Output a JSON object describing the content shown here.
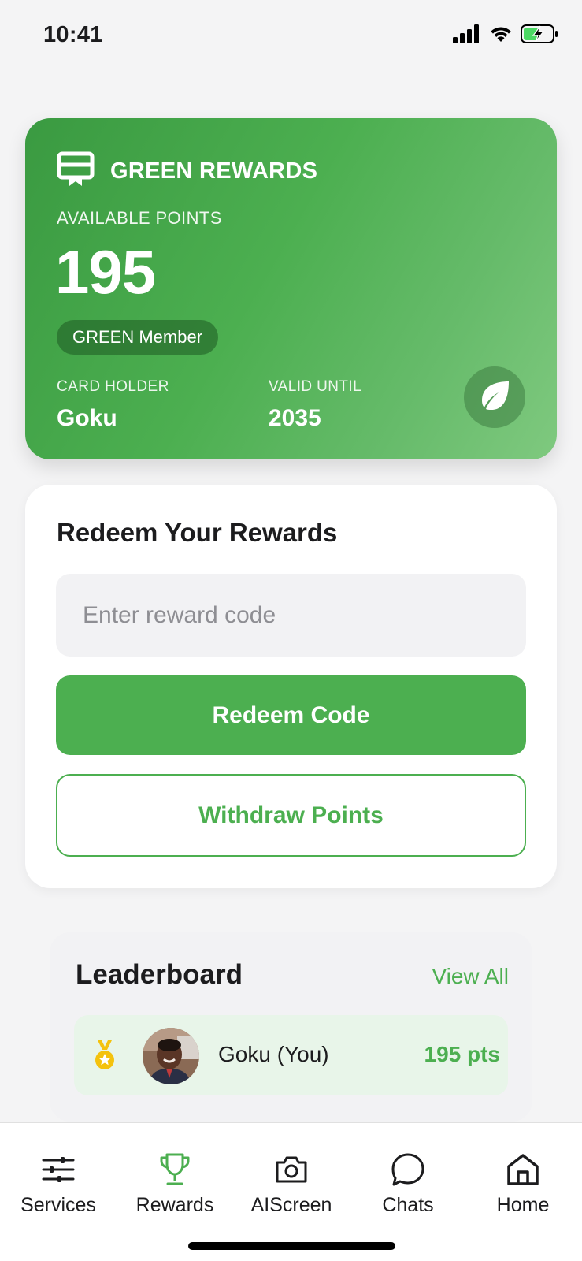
{
  "status_bar": {
    "time": "10:41",
    "icons": [
      "cellular-signal-icon",
      "wifi-icon",
      "battery-charging-icon"
    ]
  },
  "reward_card": {
    "brand_title": "GREEN REWARDS",
    "points_label": "AVAILABLE POINTS",
    "points": "195",
    "membership": "GREEN Member",
    "card_holder_label": "CARD HOLDER",
    "card_holder": "Goku",
    "valid_until_label": "VALID UNTIL",
    "valid_until": "2035",
    "colors": {
      "gradient_start": "#3a9a41",
      "gradient_end": "#7fc97f"
    }
  },
  "redeem": {
    "title": "Redeem Your Rewards",
    "input_placeholder": "Enter reward code",
    "input_value": "",
    "redeem_button": "Redeem Code",
    "withdraw_button": "Withdraw Points",
    "accent": "#4caf50"
  },
  "leaderboard": {
    "title": "Leaderboard",
    "view_all": "View All",
    "entries": [
      {
        "name": "Goku (You)",
        "points": "195 pts",
        "medal": "gold-medal-icon"
      }
    ]
  },
  "tab_bar": {
    "tabs": [
      {
        "label": "Services",
        "icon": "sliders-icon"
      },
      {
        "label": "Rewards",
        "icon": "trophy-icon",
        "active": true
      },
      {
        "label": "AIScreen",
        "icon": "camera-icon"
      },
      {
        "label": "Chats",
        "icon": "chat-bubble-icon"
      },
      {
        "label": "Home",
        "icon": "home-icon"
      }
    ],
    "active_color": "#4caf50"
  }
}
